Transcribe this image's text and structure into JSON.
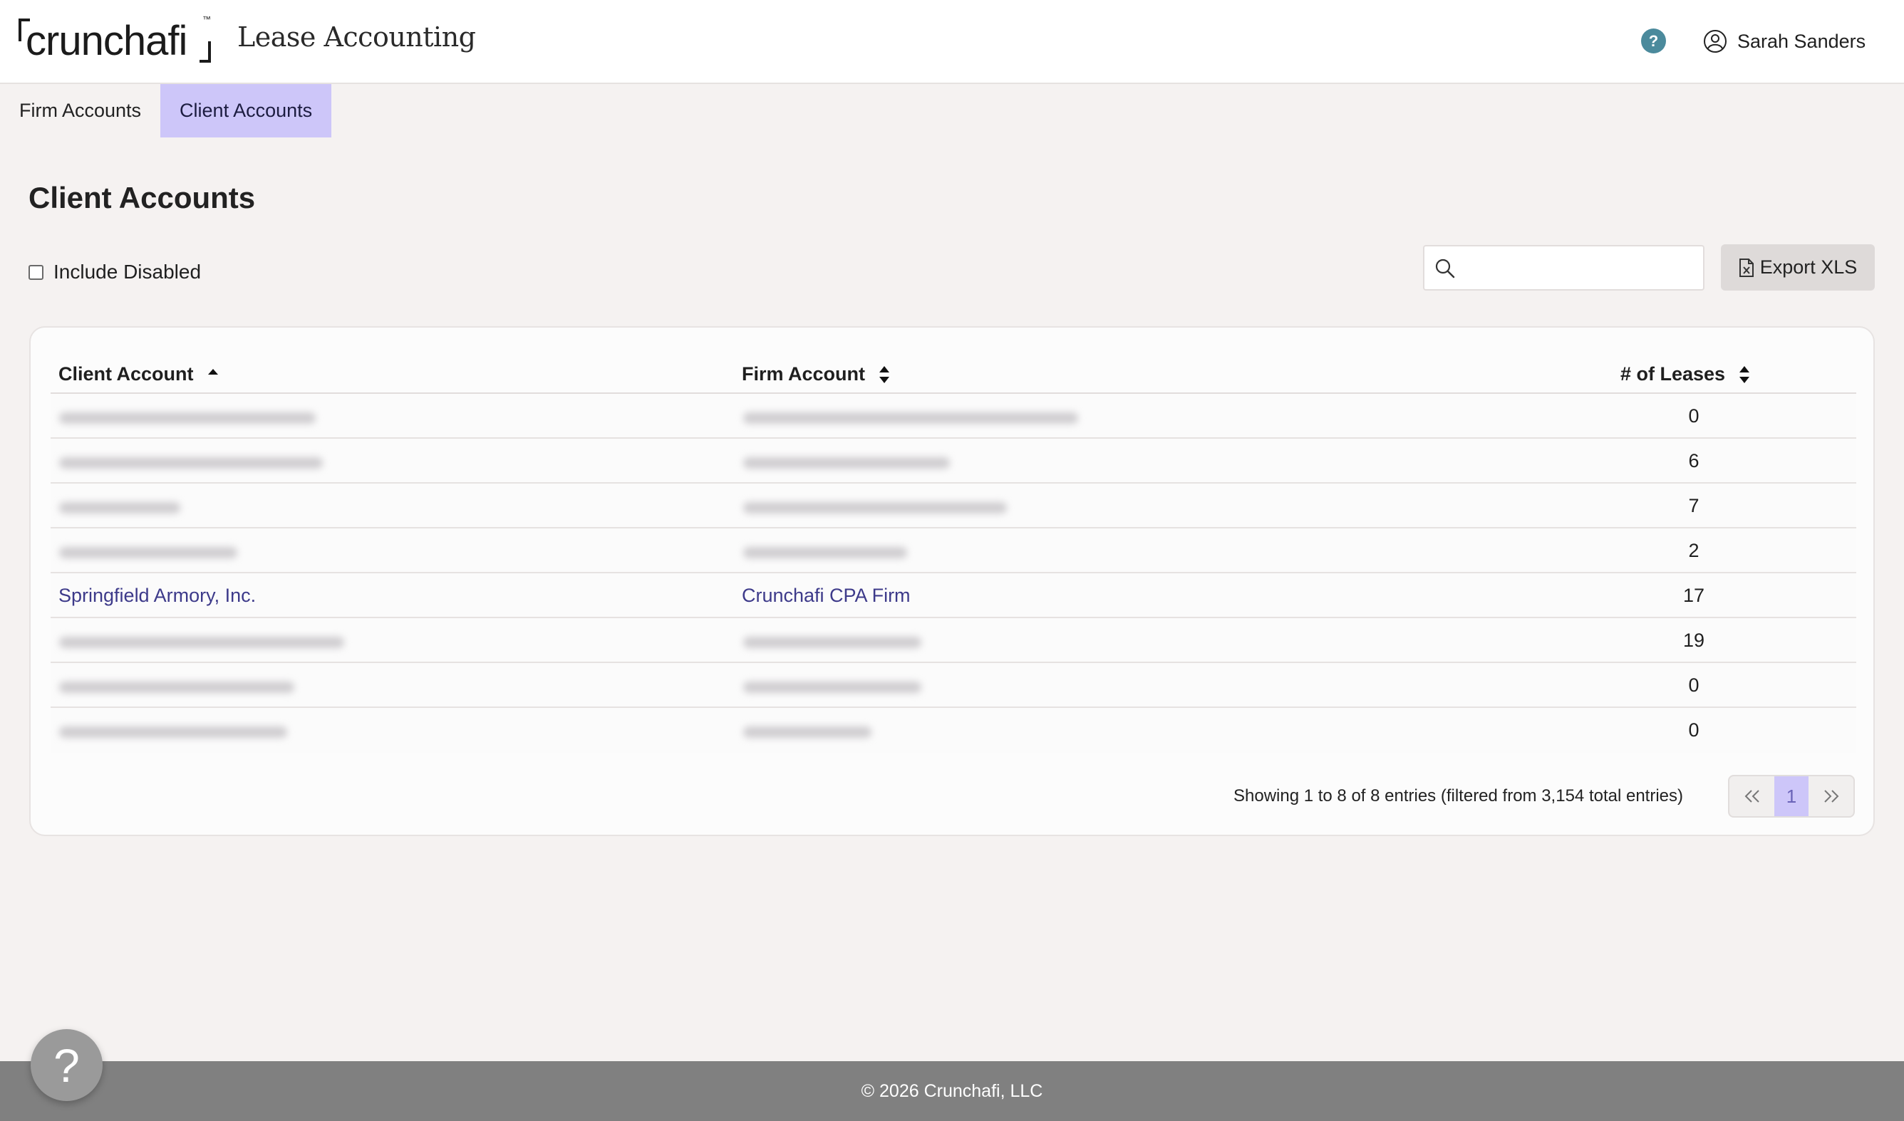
{
  "app": {
    "logo_text": "crunchafi",
    "logo_tm": "™",
    "product_name": "Lease Accounting",
    "help_glyph": "?",
    "user_name": "Sarah Sanders"
  },
  "tabs": [
    {
      "label": "Firm Accounts",
      "active": false
    },
    {
      "label": "Client Accounts",
      "active": true
    }
  ],
  "page": {
    "title": "Client Accounts",
    "include_disabled_label": "Include Disabled",
    "include_disabled_checked": false,
    "search_value": "",
    "search_placeholder": "",
    "export_label": "Export XLS"
  },
  "table": {
    "headers": {
      "client_account": "Client Account",
      "firm_account": "Firm Account",
      "leases": "# of Leases"
    },
    "rows": [
      {
        "client": "",
        "firm": "",
        "leases": "0",
        "redacted": true
      },
      {
        "client": "",
        "firm": "",
        "leases": "6",
        "redacted": true
      },
      {
        "client": "",
        "firm": "",
        "leases": "7",
        "redacted": true
      },
      {
        "client": "",
        "firm": "",
        "leases": "2",
        "redacted": true
      },
      {
        "client": "Springfield Armory, Inc.",
        "firm": "Crunchafi CPA Firm",
        "leases": "17",
        "redacted": false
      },
      {
        "client": "",
        "firm": "",
        "leases": "19",
        "redacted": true
      },
      {
        "client": "",
        "firm": "",
        "leases": "0",
        "redacted": true
      },
      {
        "client": "",
        "firm": "",
        "leases": "0",
        "redacted": true
      }
    ],
    "info": "Showing 1 to 8 of 8 entries (filtered from 3,154 total entries)",
    "current_page": "1"
  },
  "footer": {
    "copyright": "©  2026 Crunchafi, LLC",
    "help_glyph": "?"
  },
  "colors": {
    "accent": "#cdc6f9",
    "link": "#3d3a8a",
    "help": "#4b8a9c",
    "footer": "#808080"
  }
}
